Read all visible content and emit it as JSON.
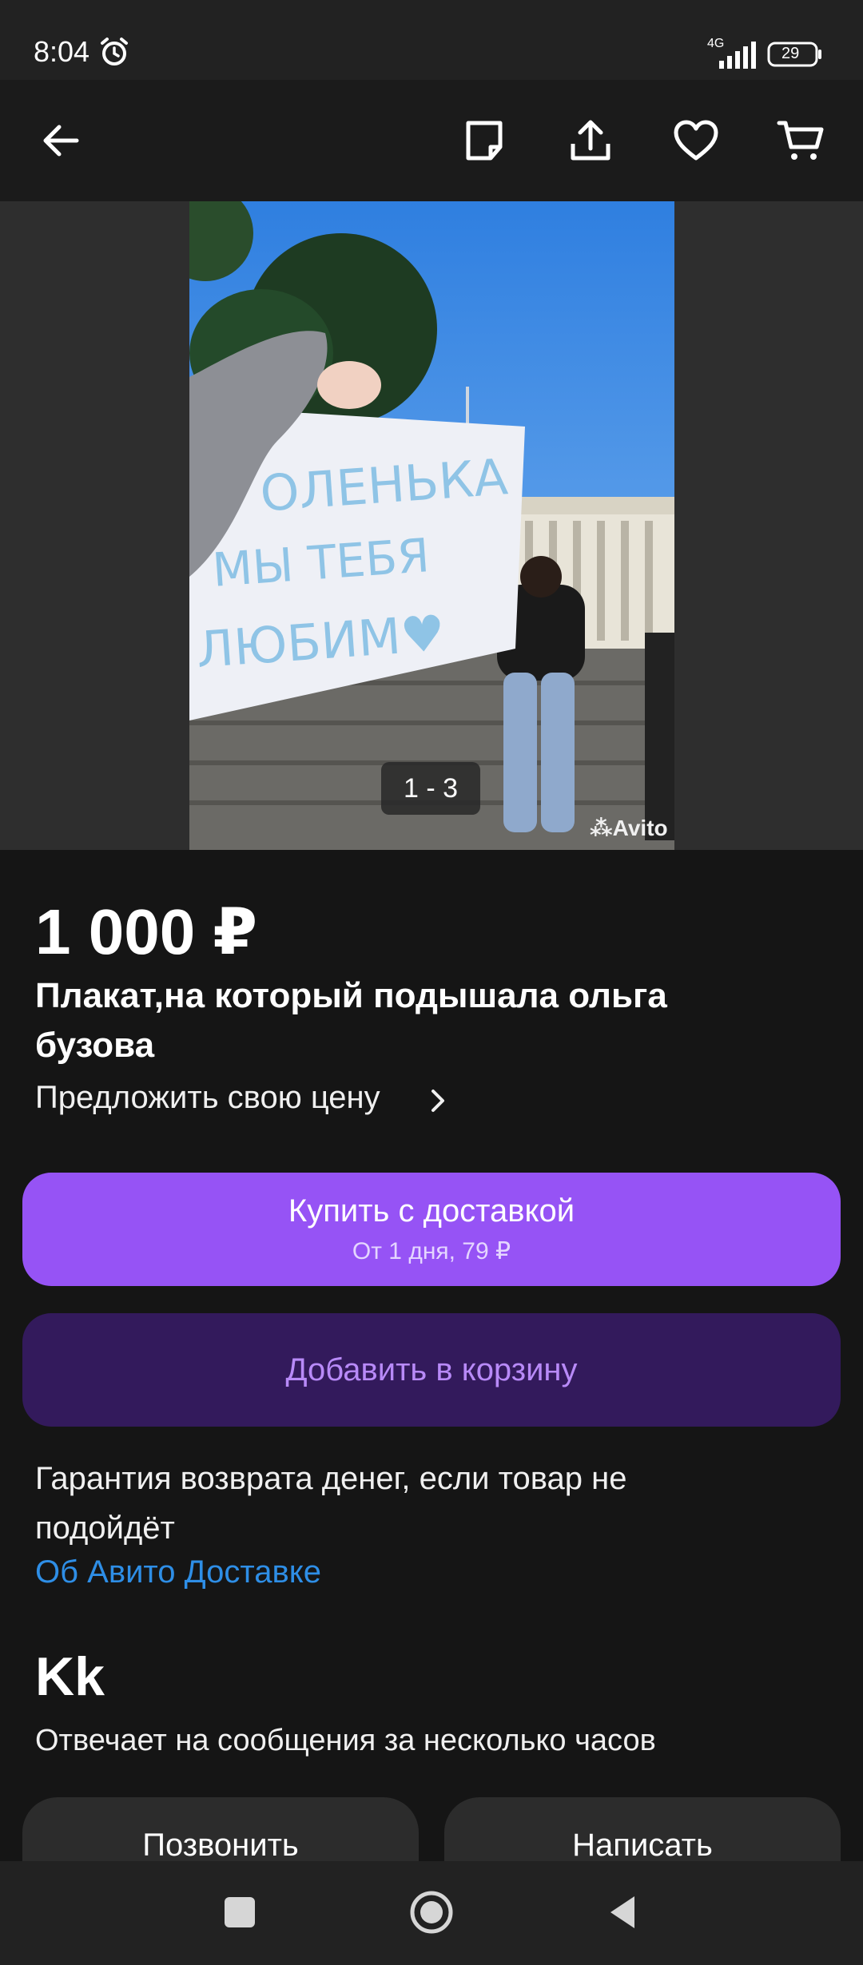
{
  "status_bar": {
    "time": "8:04",
    "network": "4G",
    "battery": "29"
  },
  "toolbar": {
    "icons": [
      "back-arrow-icon",
      "note-icon",
      "share-icon",
      "heart-icon",
      "cart-icon"
    ]
  },
  "gallery": {
    "counter": "1 - 3",
    "watermark": "Avito"
  },
  "listing": {
    "price": "1 000 ₽",
    "title": "Плакат,на который подышала ольга бузова",
    "offer_price": "Предложить свою цену"
  },
  "buttons": {
    "buy_label": "Купить с доставкой",
    "buy_sub": "От 1 дня, 79 ₽",
    "cart_label": "Добавить в корзину",
    "call_label": "Позвонить",
    "write_label": "Написать"
  },
  "delivery": {
    "guarantee": "Гарантия возврата денег, если товар не подойдёт",
    "about_link": "Об Авито Доставке"
  },
  "seller": {
    "name": "Kk",
    "response": "Отвечает на сообщения за несколько часов"
  },
  "colors": {
    "accent": "#9653f5",
    "cart_bg": "#331a5c",
    "cart_text": "#b88af8",
    "link": "#2e8ee6",
    "background": "#151515"
  }
}
